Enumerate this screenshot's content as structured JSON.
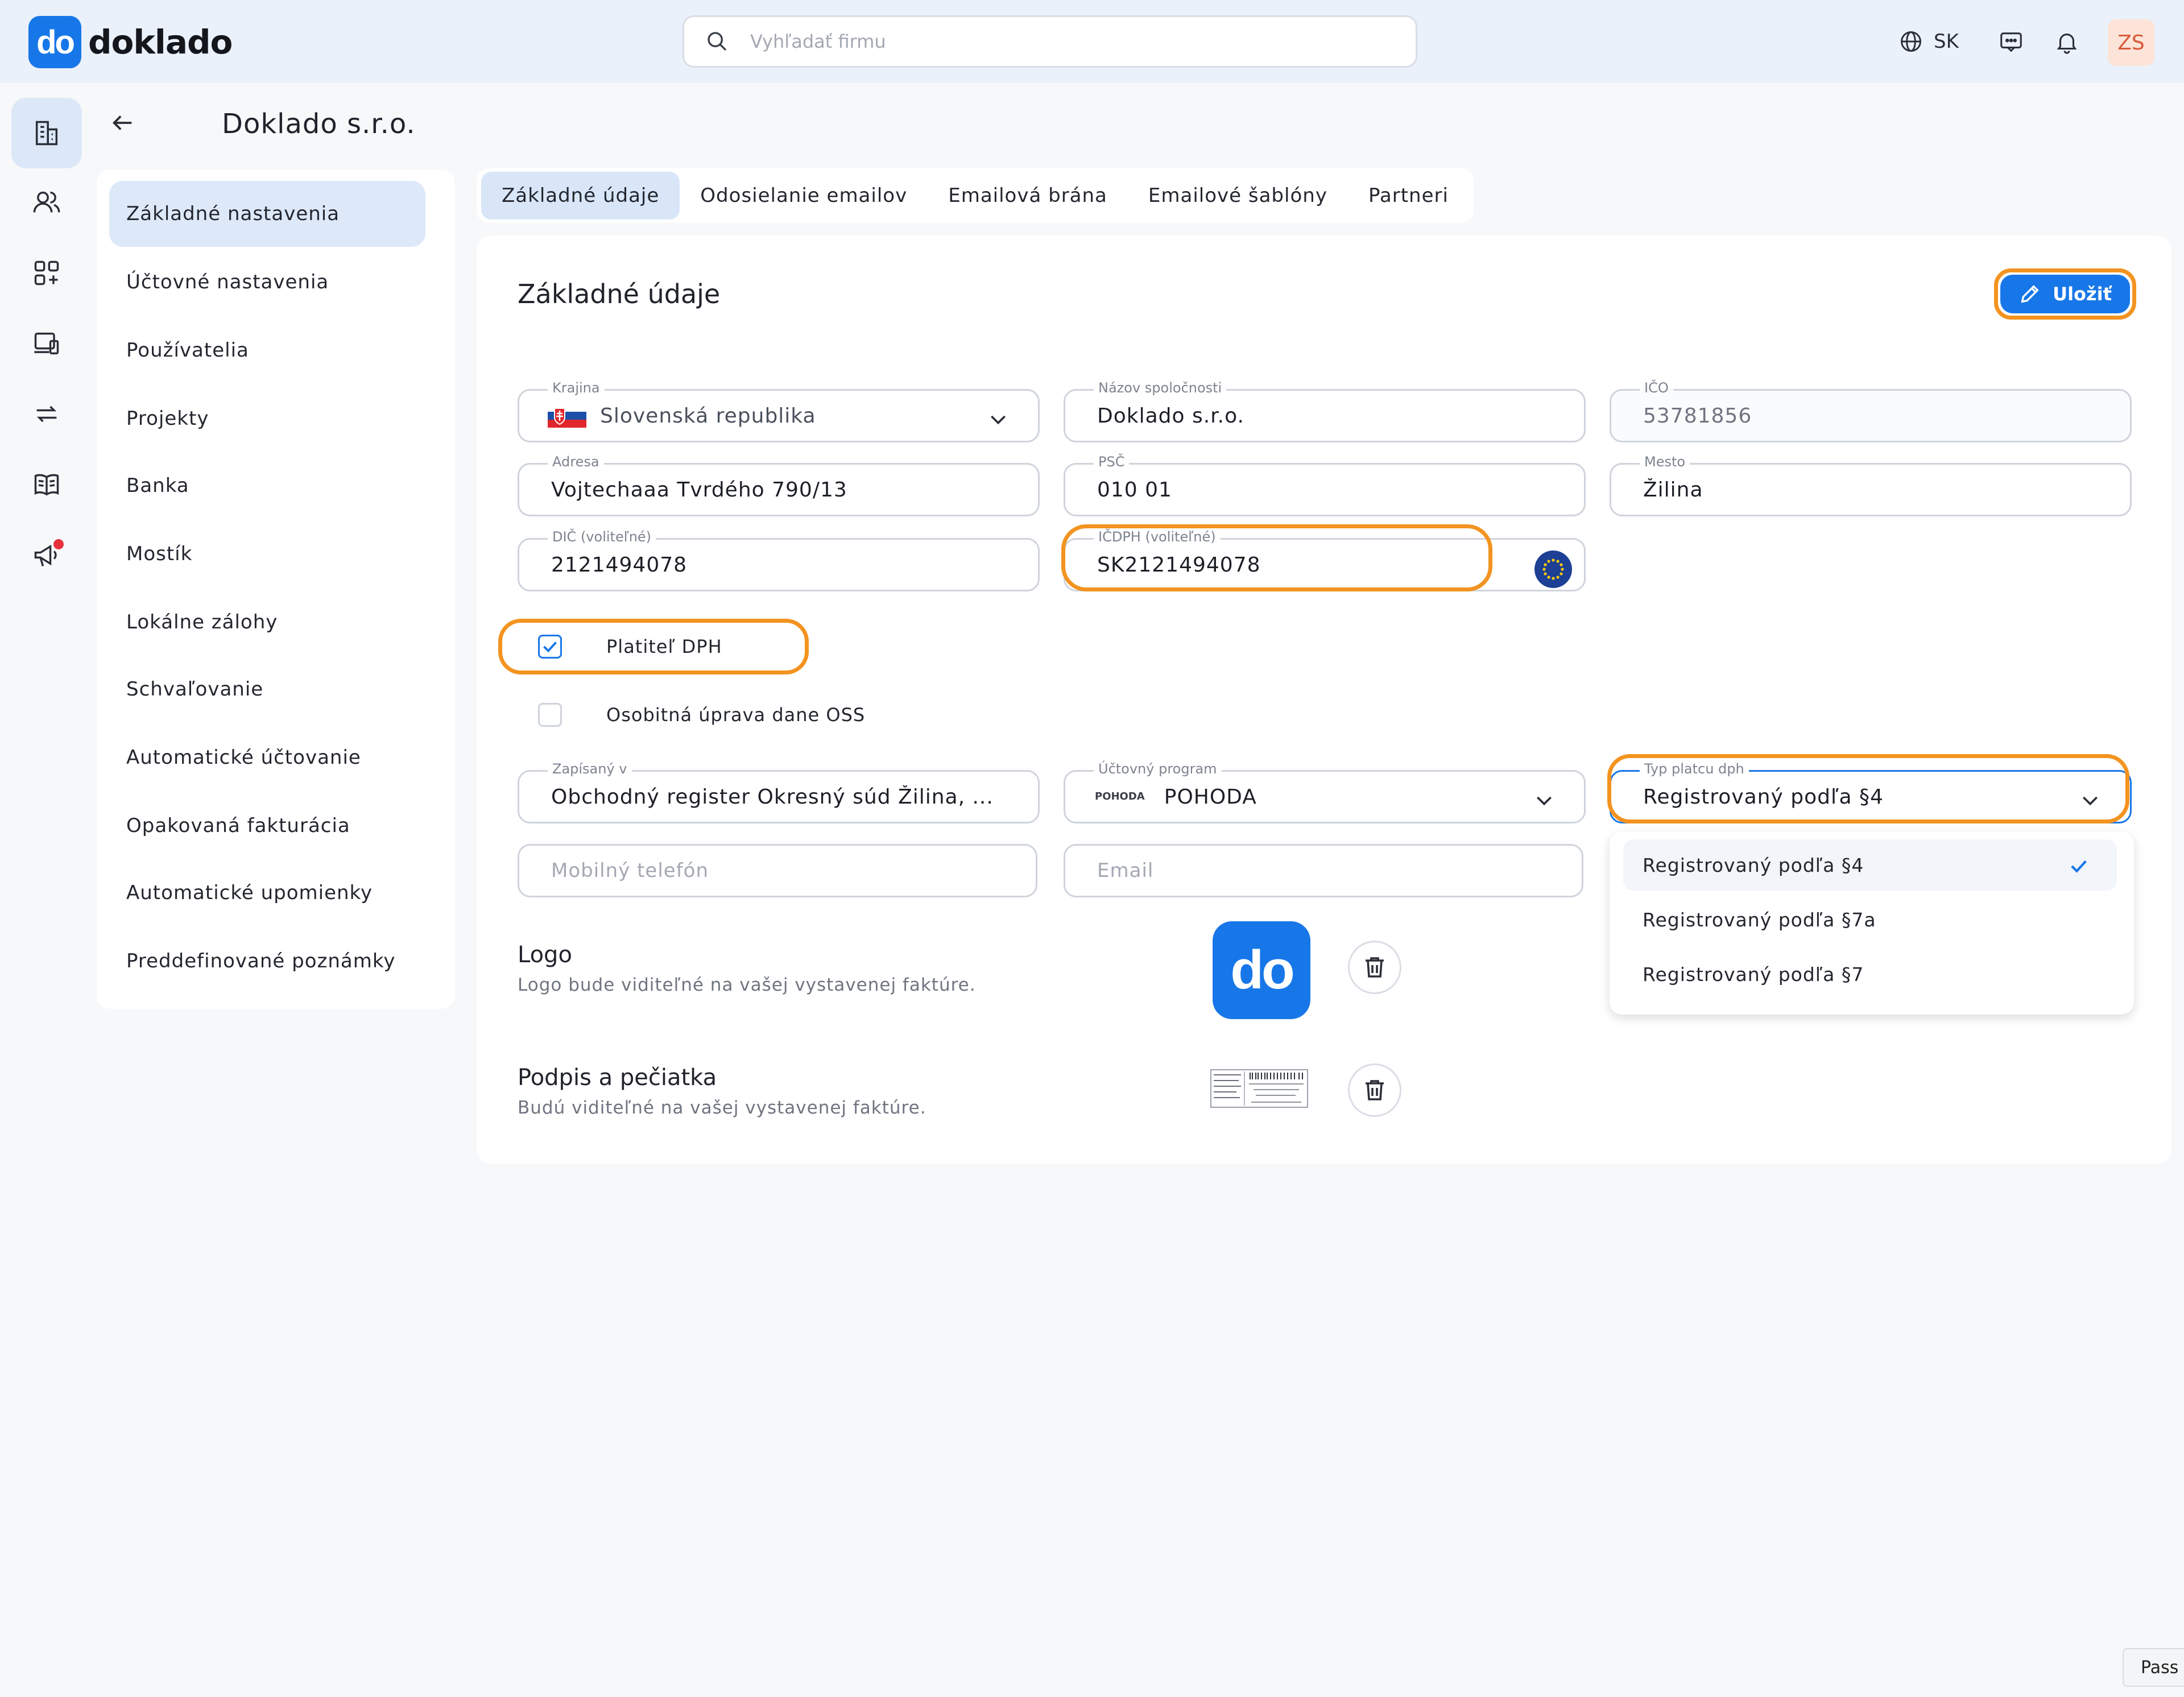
{
  "app": {
    "logo_mark": "do",
    "logo_text": "doklado"
  },
  "header": {
    "search_placeholder": "Vyhľadať firmu",
    "language": "SK",
    "avatar_initials": "ZS"
  },
  "page": {
    "title": "Doklado s.r.o."
  },
  "settings_menu": [
    {
      "label": "Základné nastavenia",
      "active": true
    },
    {
      "label": "Účtovné nastavenia",
      "active": false
    },
    {
      "label": "Používatelia",
      "active": false
    },
    {
      "label": "Projekty",
      "active": false
    },
    {
      "label": "Banka",
      "active": false
    },
    {
      "label": "Mostík",
      "active": false
    },
    {
      "label": "Lokálne zálohy",
      "active": false
    },
    {
      "label": "Schvaľovanie",
      "active": false
    },
    {
      "label": "Automatické účtovanie",
      "active": false
    },
    {
      "label": "Opakovaná fakturácia",
      "active": false
    },
    {
      "label": "Automatické upomienky",
      "active": false
    },
    {
      "label": "Preddefinované poznámky",
      "active": false
    }
  ],
  "tabs": [
    {
      "label": "Základné údaje",
      "active": true
    },
    {
      "label": "Odosielanie emailov",
      "active": false
    },
    {
      "label": "Emailová brána",
      "active": false
    },
    {
      "label": "Emailové šablóny",
      "active": false
    },
    {
      "label": "Partneri",
      "active": false
    }
  ],
  "card": {
    "title": "Základné údaje",
    "save_label": "Uložiť"
  },
  "form": {
    "country": {
      "label": "Krajina",
      "value": "Slovenská republika"
    },
    "company_name": {
      "label": "Názov spoločnosti",
      "value": "Doklado s.r.o."
    },
    "ico": {
      "label": "IČO",
      "value": "53781856"
    },
    "address": {
      "label": "Adresa",
      "value": "Vojtechaaa Tvrdého 790/13"
    },
    "psc": {
      "label": "PSČ",
      "value": "010 01"
    },
    "city": {
      "label": "Mesto",
      "value": "Žilina"
    },
    "dic": {
      "label": "DIČ (voliteľné)",
      "value": "2121494078"
    },
    "icdph": {
      "label": "IČDPH (voliteľné)",
      "value": "SK2121494078"
    },
    "vat_payer": {
      "label": "Platiteľ DPH",
      "checked": true
    },
    "oss": {
      "label": "Osobitná úprava dane OSS",
      "checked": false
    },
    "registered_in": {
      "label": "Zapísaný v",
      "value": "Obchodný register Okresný súd Žilina, ..."
    },
    "accounting_program": {
      "label": "Účtovný program",
      "logo_text": "POHODA",
      "value": "POHODA"
    },
    "vat_type": {
      "label": "Typ platcu dph",
      "value": "Registrovaný podľa §4"
    },
    "mobile": {
      "placeholder": "Mobilný telefón"
    },
    "email": {
      "placeholder": "Email"
    }
  },
  "vat_type_options": [
    {
      "label": "Registrovaný podľa §4",
      "selected": true
    },
    {
      "label": "Registrovaný podľa §7a",
      "selected": false
    },
    {
      "label": "Registrovaný podľa §7",
      "selected": false
    }
  ],
  "logo_section": {
    "title": "Logo",
    "description": "Logo bude viditeľné na vašej vystavenej faktúre.",
    "logo_mark": "do"
  },
  "signature_section": {
    "title": "Podpis a pečiatka",
    "description": "Budú viditeľné na vašej vystavenej faktúre."
  },
  "extension_tab": "Pass",
  "colors": {
    "accent": "#1877e8",
    "highlight": "#f39320",
    "topbar": "#eaf1fa"
  }
}
